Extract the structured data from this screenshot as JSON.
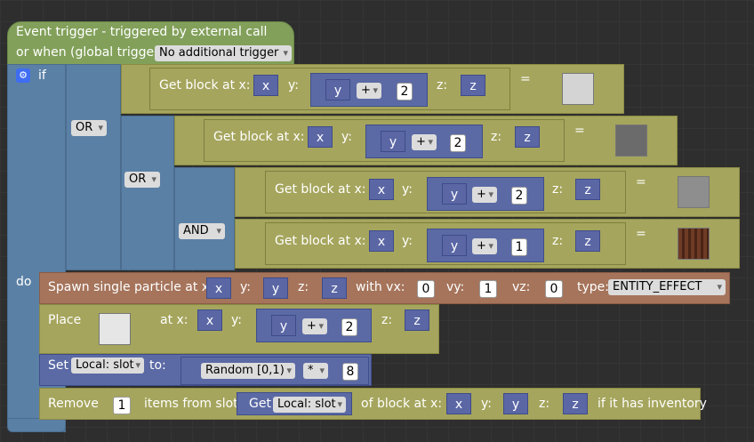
{
  "hat": {
    "line1": "Event trigger - triggered by external call",
    "line2": "or when (global trigger):",
    "trigger_option": "No additional trigger"
  },
  "if_block": {
    "if_label": "if",
    "do_label": "do",
    "or_label": "OR",
    "and_label": "AND"
  },
  "getblock": {
    "label": "Get block at x:",
    "y_label": "y:",
    "z_label": "z:",
    "x_var": "x",
    "y_var": "y",
    "z_var": "z",
    "plus": "+",
    "eq": "=",
    "num2": "2",
    "num1": "1"
  },
  "particle": {
    "label": "Spawn single particle at x:",
    "x": "x",
    "y_label": "y:",
    "y": "y",
    "z_label": "z:",
    "z": "z",
    "vx_label": "with vx:",
    "vx": "0",
    "vy_label": "vy:",
    "vy": "1",
    "vz_label": "vz:",
    "vz": "0",
    "type_label": "type:",
    "type": "ENTITY_EFFECT"
  },
  "place": {
    "label": "Place",
    "at_x": "at x:",
    "x": "x",
    "y_label": "y:",
    "y": "y",
    "plus": "+",
    "num": "2",
    "z_label": "z:",
    "z": "z"
  },
  "set": {
    "label": "Set",
    "var": "Local: slot",
    "to": "to:",
    "random": "Random [0,1)",
    "op": "*",
    "num": "8"
  },
  "remove": {
    "label": "Remove",
    "count": "1",
    "items_from": "items from slot",
    "get": "Get",
    "var": "Local: slot",
    "of_block": "of block at x:",
    "x": "x",
    "y_label": "y:",
    "y": "y",
    "z_label": "z:",
    "z": "z",
    "suffix": "if it has inventory"
  },
  "colors": {
    "hat": "#82a05a",
    "if": "#5b80a5",
    "olive": "#a5a55d",
    "brown": "#a5745b",
    "var": "#5b67a5"
  }
}
